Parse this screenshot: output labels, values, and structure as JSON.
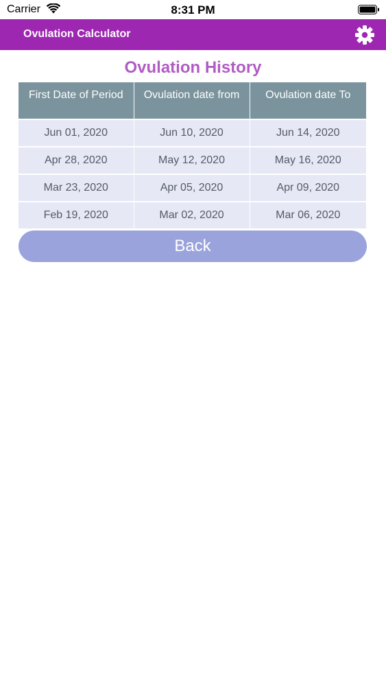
{
  "status_bar": {
    "carrier": "Carrier",
    "time": "8:31 PM"
  },
  "nav": {
    "title": "Ovulation Calculator",
    "settings_icon": "gear-icon"
  },
  "heading": "Ovulation History",
  "table": {
    "headers": [
      "First Date of Period",
      "Ovulation date from",
      "Ovulation date To"
    ],
    "rows": [
      [
        "Jun 01, 2020",
        "Jun 10, 2020",
        "Jun 14, 2020"
      ],
      [
        "Apr 28, 2020",
        "May 12, 2020",
        "May 16, 2020"
      ],
      [
        "Mar 23, 2020",
        "Apr 05, 2020",
        "Apr 09, 2020"
      ],
      [
        "Feb 19, 2020",
        "Mar 02, 2020",
        "Mar 06, 2020"
      ]
    ]
  },
  "back_label": "Back",
  "colors": {
    "nav_bar": "#9d27b0",
    "heading": "#b05cc3",
    "table_header": "#7a939c",
    "table_row": "#e6e8f6",
    "back_button": "#9aa3dc"
  }
}
